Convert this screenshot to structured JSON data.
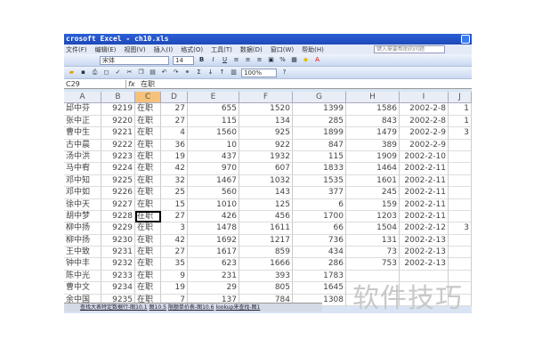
{
  "window": {
    "title": "crosoft Excel - ch10.xls"
  },
  "menu": [
    "文件(F)",
    "编辑(E)",
    "视图(V)",
    "插入(I)",
    "格式(O)",
    "工具(T)",
    "数据(D)",
    "窗口(W)",
    "帮助(H)"
  ],
  "help_placeholder": "键入需要帮助的问题",
  "toolbar": {
    "font": "宋体",
    "size": "14",
    "zoom": "100%"
  },
  "formula_bar": {
    "name_box": "C29",
    "fx": "fx",
    "value": "在职"
  },
  "columns": [
    "A",
    "B",
    "C",
    "D",
    "E",
    "F",
    "G",
    "H",
    "I",
    "J"
  ],
  "rows": [
    [
      "邱中芬",
      "9219",
      "在职",
      "27",
      "655",
      "1520",
      "1399",
      "1586",
      "2002-2-8",
      "1"
    ],
    [
      "张中正",
      "9220",
      "在职",
      "27",
      "115",
      "134",
      "285",
      "843",
      "2002-2-8",
      "1"
    ],
    [
      "曹中生",
      "9221",
      "在职",
      "4",
      "1560",
      "925",
      "1899",
      "1479",
      "2002-2-9",
      "3"
    ],
    [
      "古中晨",
      "9222",
      "在职",
      "36",
      "10",
      "922",
      "847",
      "389",
      "2002-2-9",
      ""
    ],
    [
      "汤中洪",
      "9223",
      "在职",
      "19",
      "437",
      "1932",
      "115",
      "1909",
      "2002-2-10",
      ""
    ],
    [
      "马中宥",
      "9224",
      "在职",
      "42",
      "970",
      "607",
      "1833",
      "1464",
      "2002-2-11",
      ""
    ],
    [
      "邓中知",
      "9225",
      "在职",
      "32",
      "1467",
      "1032",
      "1535",
      "1601",
      "2002-2-11",
      ""
    ],
    [
      "邓中如",
      "9226",
      "在职",
      "25",
      "560",
      "143",
      "377",
      "245",
      "2002-2-11",
      ""
    ],
    [
      "徐中天",
      "9227",
      "在职",
      "15",
      "1010",
      "125",
      "6",
      "159",
      "2002-2-11",
      ""
    ],
    [
      "胡中梦",
      "9228",
      "在职",
      "27",
      "426",
      "456",
      "1700",
      "1203",
      "2002-2-11",
      ""
    ],
    [
      "柳中扬",
      "9229",
      "在职",
      "3",
      "1478",
      "1611",
      "66",
      "1504",
      "2002-2-12",
      "3"
    ],
    [
      "柳中扬",
      "9230",
      "在职",
      "42",
      "1692",
      "1217",
      "736",
      "131",
      "2002-2-13",
      ""
    ],
    [
      "王中致",
      "9231",
      "在职",
      "27",
      "1617",
      "859",
      "434",
      "73",
      "2002-2-13",
      ""
    ],
    [
      "钟中丰",
      "9232",
      "在职",
      "35",
      "623",
      "1666",
      "286",
      "753",
      "2002-2-13",
      ""
    ],
    [
      "陈中光",
      "9233",
      "在职",
      "9",
      "231",
      "393",
      "1783",
      "",
      "",
      ""
    ],
    [
      "曹中文",
      "9234",
      "在职",
      "19",
      "29",
      "805",
      "1645",
      "",
      "",
      ""
    ],
    [
      "余中国",
      "9235",
      "在职",
      "7",
      "137",
      "784",
      "1308",
      "",
      "",
      ""
    ]
  ],
  "sheet_tabs": [
    "查找大表特定数据行-图10.1",
    "图10.5",
    "限额单价表-图10.6",
    "lookup来查找-图1"
  ],
  "watermark": "软件技巧"
}
